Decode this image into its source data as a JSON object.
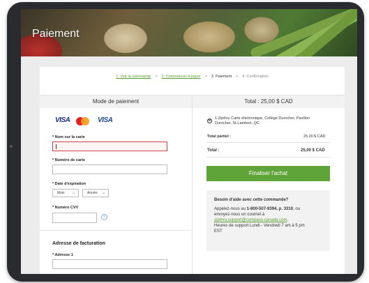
{
  "page": {
    "title": "Paiement"
  },
  "breadcrumb": {
    "steps": [
      {
        "label": "1. Voir la commande",
        "state": "done"
      },
      {
        "label": "2. Commencer à payer",
        "state": "done"
      },
      {
        "label": "3. Paiement",
        "state": "current"
      },
      {
        "label": "4. Confirmation",
        "state": "pending"
      }
    ],
    "separator": ">"
  },
  "payment": {
    "heading": "Mode de paiement",
    "card_brands": [
      "VISA",
      "mastercard-logo",
      "VISA"
    ],
    "card_name_label": "* Nom sur la carte",
    "card_name_value": "",
    "card_number_label": "* Numéro de carte",
    "card_number_value": "",
    "expiry_label": "* Date d'expiration",
    "month_placeholder": "Mois",
    "year_placeholder": "Année",
    "cvv_label": "* Numéro CVV",
    "cvv_value": "",
    "cvv_help_icon": "?",
    "billing_heading": "Adresse de facturation",
    "address1_label": "* Adresse 1"
  },
  "summary": {
    "heading": "Total : 25,00 $ CAD",
    "item_line1": "1 Zipthru Carte électronique, Collège Durocher, Pavillon",
    "item_line2": "Durocher, St-Lambert, QC",
    "remove_icon": "⊗",
    "subtotal_label": "Total partiel :",
    "subtotal_value": "25,00 $ CAD",
    "total_label": "Total :",
    "total_value": "25,00 $ CAD",
    "checkout_button": "Finaliser l'achat"
  },
  "help": {
    "title": "Besoin d'aide avec cette commande?",
    "line1_prefix": "Appelez-nous au ",
    "phone": "1-800-507-9394, p. 3310",
    "line1_suffix": ", ou",
    "line2": "envoyez-nous un courriel à",
    "email": "zipthru.support@compass-canada.com",
    "email_suffix": ".",
    "hours_line1": "Heures de support Lundi - Vendredi 7 am à 5 pm",
    "hours_line2": "EST"
  },
  "colors": {
    "accent": "#5fa438",
    "link": "#5b9a2e",
    "error_border": "#c9414a"
  }
}
